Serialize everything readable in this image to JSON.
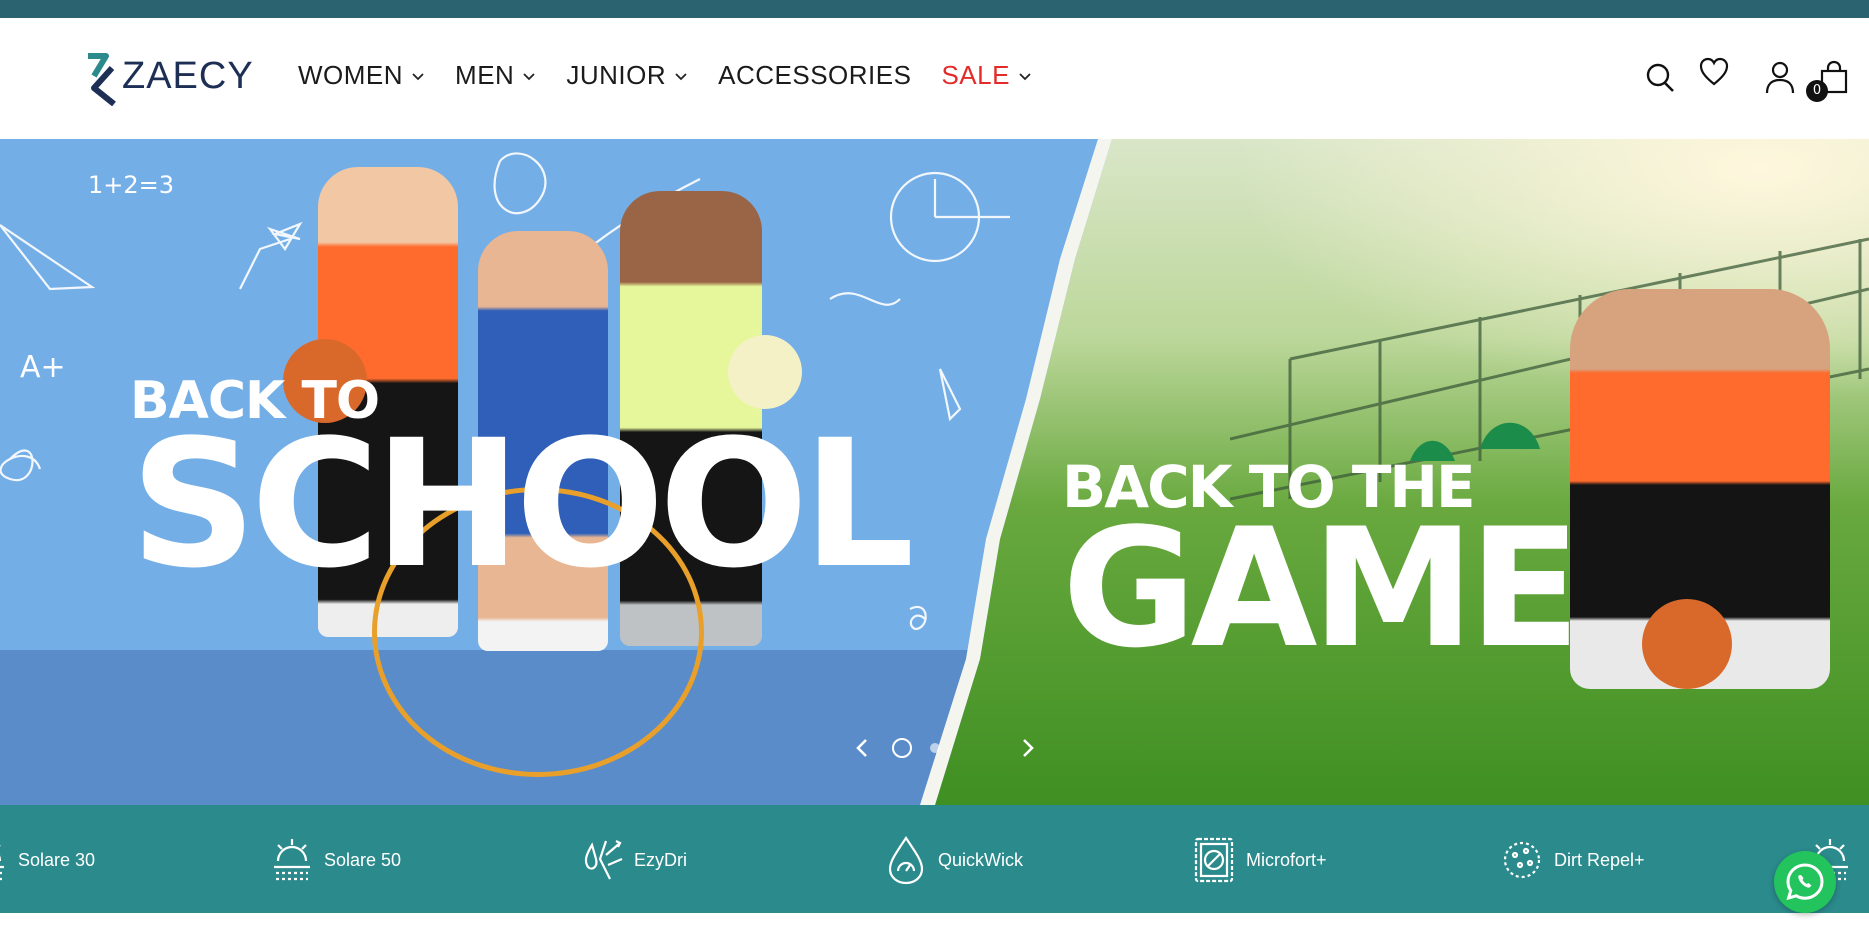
{
  "brand": {
    "name": "ZAECY"
  },
  "nav": {
    "items": [
      {
        "label": "WOMEN",
        "has_dropdown": true,
        "color": "#1b1b1b"
      },
      {
        "label": "MEN",
        "has_dropdown": true,
        "color": "#1b1b1b"
      },
      {
        "label": "JUNIOR",
        "has_dropdown": true,
        "color": "#1b1b1b"
      },
      {
        "label": "ACCESSORIES",
        "has_dropdown": false,
        "color": "#1b1b1b"
      },
      {
        "label": "SALE",
        "has_dropdown": true,
        "color": "#e52a2a"
      }
    ]
  },
  "header_icons": {
    "search": "search-icon",
    "wishlist": "heart-icon",
    "account": "user-icon",
    "cart": "bag-icon",
    "cart_count": "0"
  },
  "hero": {
    "left_line1": "BACK TO",
    "left_line2": "SCHOOL",
    "right_line1": "BACK TO THE",
    "right_line2": "GAME",
    "doodle_equation": "1+2=3",
    "doodle_grade": "A+",
    "slides_total": 2,
    "slide_active": 1
  },
  "features": [
    {
      "label": "Solare 30",
      "icon": "sun-icon"
    },
    {
      "label": "Solare 50",
      "icon": "sun-icon"
    },
    {
      "label": "EzyDri",
      "icon": "drops-arrows-icon"
    },
    {
      "label": "QuickWick",
      "icon": "drop-gauge-icon"
    },
    {
      "label": "Microfort+",
      "icon": "stamp-shield-icon"
    },
    {
      "label": "Dirt Repel+",
      "icon": "dots-circle-icon"
    }
  ],
  "colors": {
    "announcement_bar": "#2b6470",
    "features_bar": "#2b8a8c",
    "sale": "#e52a2a",
    "whatsapp": "#23c35e"
  }
}
